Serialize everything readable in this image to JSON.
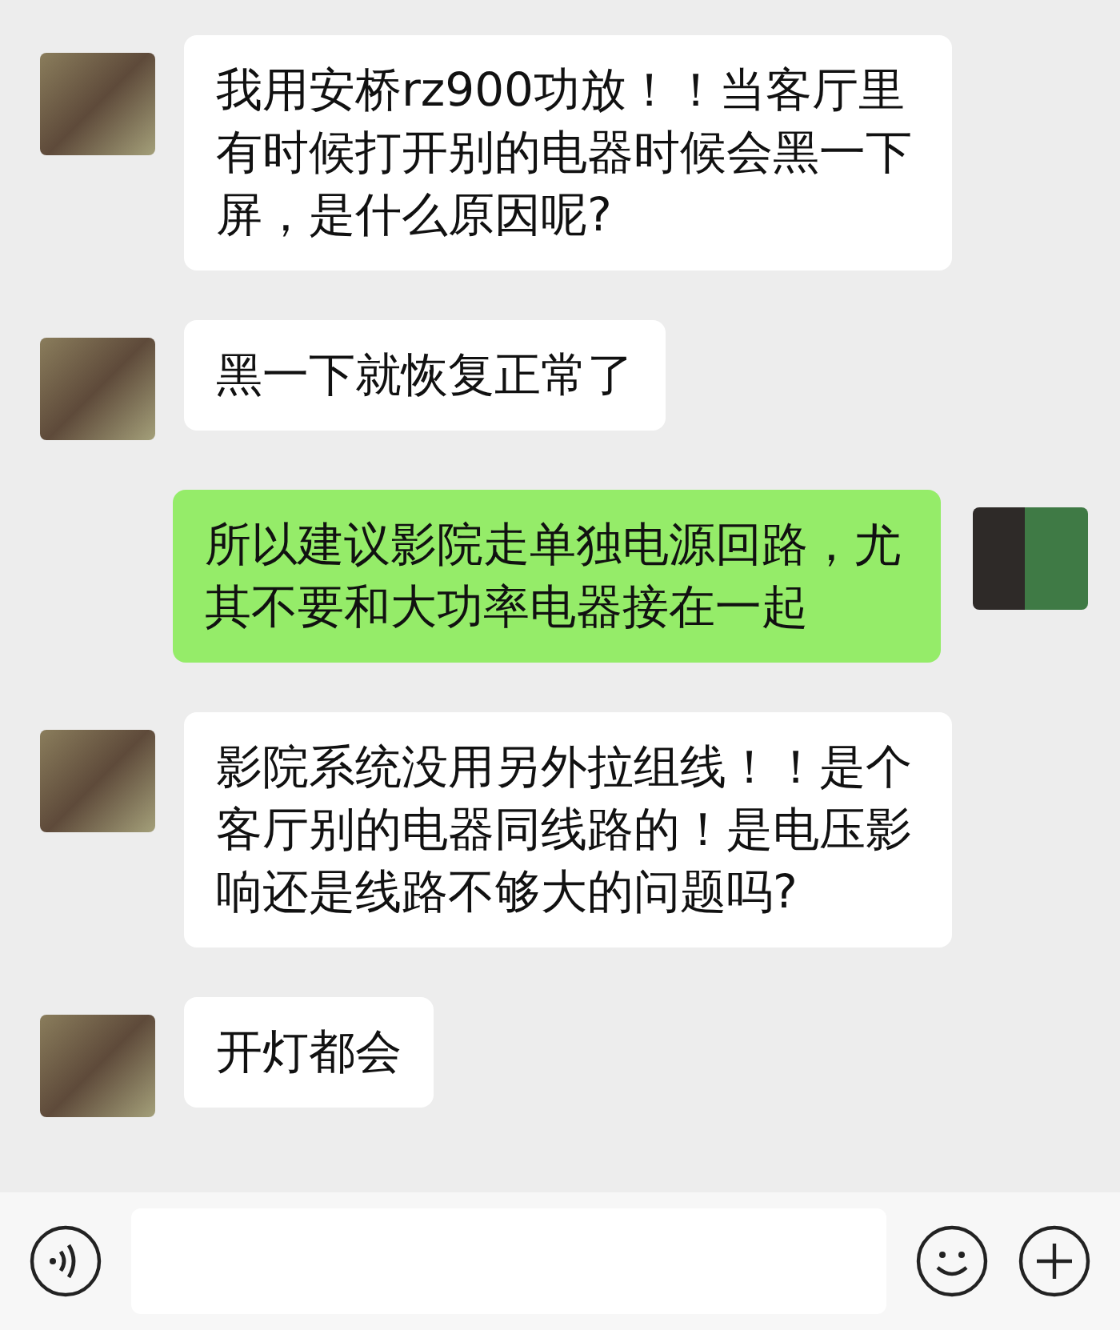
{
  "messages": [
    {
      "kind": "received",
      "text": "我用安桥rz900功放！！当客厅里有时候打开别的电器时候会黑一下屏，是什么原因呢?"
    },
    {
      "kind": "received",
      "text": "黑一下就恢复正常了"
    },
    {
      "kind": "sent",
      "text": "所以建议影院走单独电源回路，尤其不要和大功率电器接在一起"
    },
    {
      "kind": "received",
      "text": "影院系统没用另外拉组线！！是个客厅别的电器同线路的！是电压影响还是线路不够大的问题吗?"
    },
    {
      "kind": "received",
      "text": "开灯都会"
    }
  ]
}
